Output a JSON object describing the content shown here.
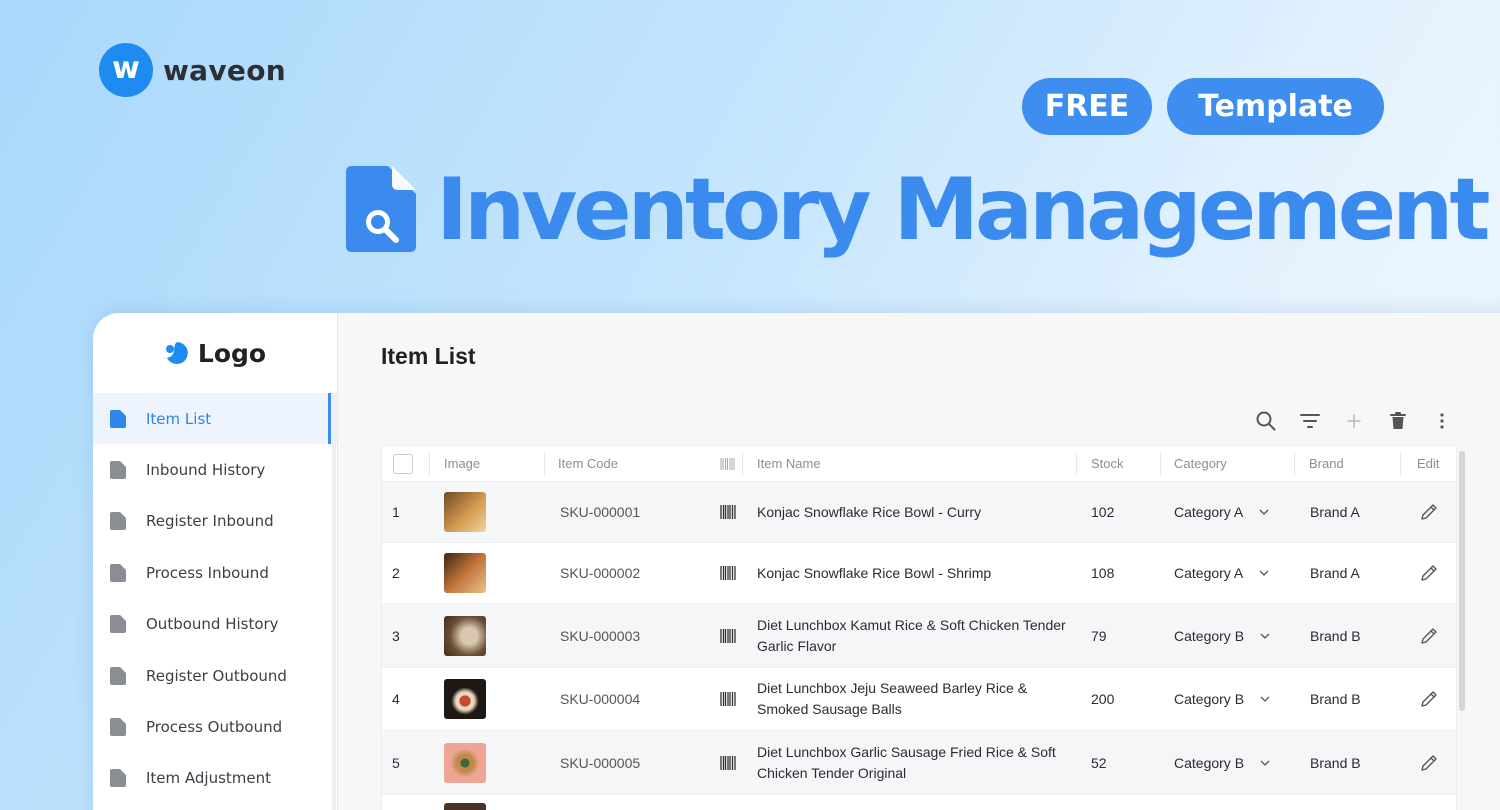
{
  "brand": {
    "name": "waveon",
    "mark_letter": "w"
  },
  "badges": {
    "free": "FREE",
    "template": "Template"
  },
  "hero": {
    "title": "Inventory Management"
  },
  "app": {
    "logo": "Logo",
    "sidebar": [
      {
        "label": "Item List",
        "active": true
      },
      {
        "label": "Inbound History"
      },
      {
        "label": "Register Inbound"
      },
      {
        "label": "Process Inbound"
      },
      {
        "label": "Outbound History"
      },
      {
        "label": "Register Outbound"
      },
      {
        "label": "Process Outbound"
      },
      {
        "label": "Item Adjustment"
      }
    ],
    "page_title": "Item List",
    "toolbar": [
      "search-icon",
      "filter-icon",
      "add-icon",
      "delete-icon",
      "more-icon"
    ],
    "table": {
      "headers": {
        "image": "Image",
        "item_code": "Item Code",
        "item_name": "Item Name",
        "stock": "Stock",
        "category": "Category",
        "brand": "Brand",
        "edit": "Edit"
      },
      "rows": [
        {
          "no": "1",
          "code": "SKU-000001",
          "name": "Konjac Snowflake Rice Bowl - Curry",
          "stock": "102",
          "category": "Category A",
          "brand": "Brand A"
        },
        {
          "no": "2",
          "code": "SKU-000002",
          "name": "Konjac Snowflake Rice Bowl - Shrimp",
          "stock": "108",
          "category": "Category A",
          "brand": "Brand A"
        },
        {
          "no": "3",
          "code": "SKU-000003",
          "name": "Diet Lunchbox Kamut Rice & Soft Chicken Tender Garlic Flavor",
          "stock": "79",
          "category": "Category B",
          "brand": "Brand B"
        },
        {
          "no": "4",
          "code": "SKU-000004",
          "name": "Diet Lunchbox Jeju Seaweed Barley Rice & Smoked Sausage Balls",
          "stock": "200",
          "category": "Category B",
          "brand": "Brand B"
        },
        {
          "no": "5",
          "code": "SKU-000005",
          "name": "Diet Lunchbox Garlic Sausage Fried Rice & Soft Chicken Tender Original",
          "stock": "52",
          "category": "Category B",
          "brand": "Brand B"
        }
      ]
    }
  },
  "colors": {
    "accent": "#3b8bef",
    "brand_blue": "#1e8bf0",
    "thumb_colors": [
      "#c98a4a",
      "#b9672e",
      "#8a6a4c",
      "#2c2520",
      "#e8a090"
    ]
  }
}
